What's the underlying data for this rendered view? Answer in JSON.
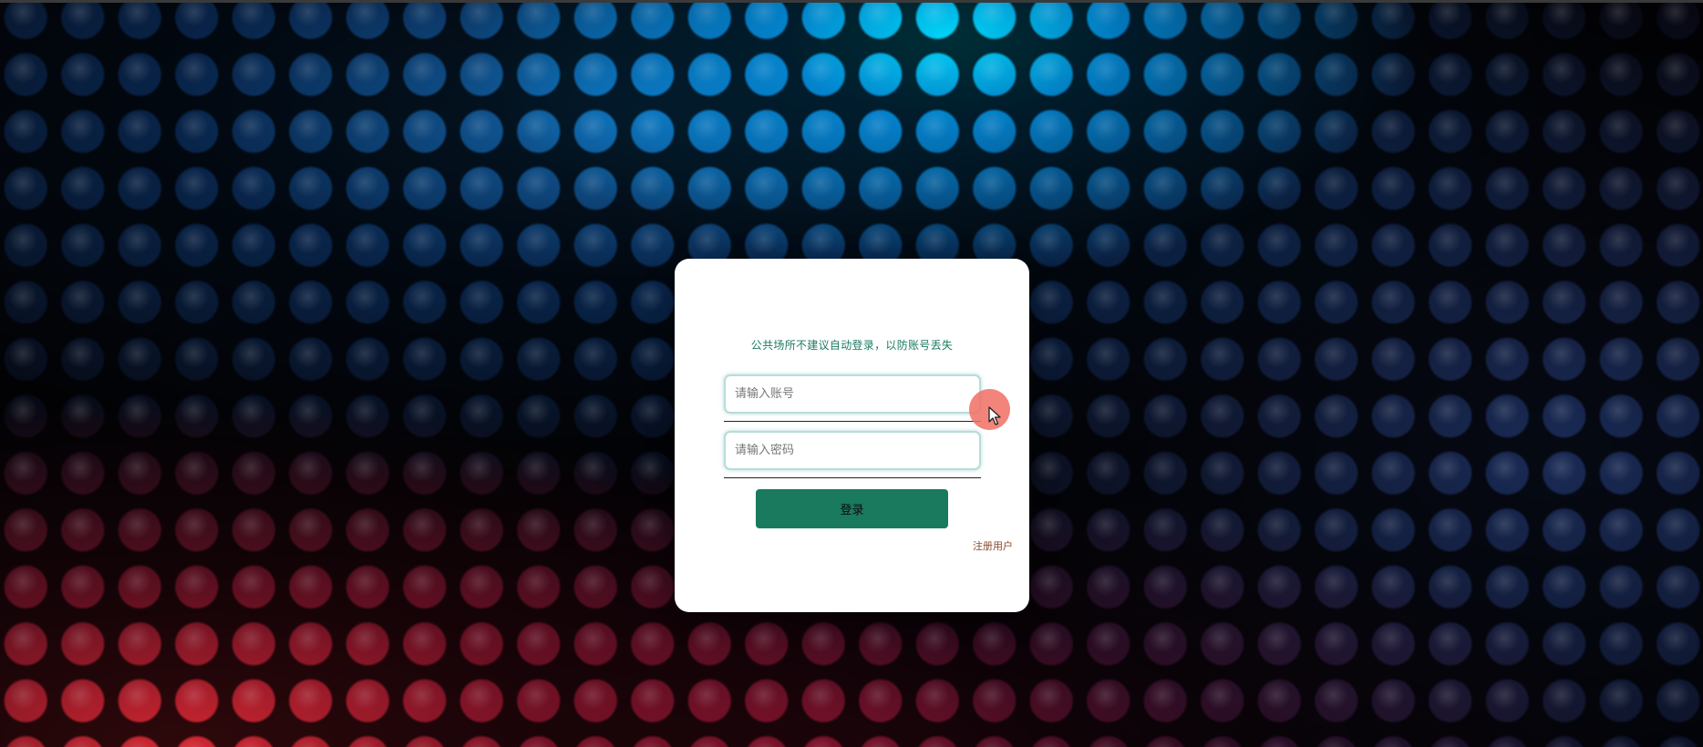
{
  "login": {
    "notice": "公共场所不建议自动登录，以防账号丢失",
    "username_placeholder": "请输入账号",
    "password_placeholder": "请输入密码",
    "login_label": "登录",
    "register_label": "注册用户"
  },
  "colors": {
    "accent": "#1a7a5e",
    "notice_text": "#1c7a62",
    "register_link": "#8a4a2a",
    "card": "#ffffff"
  },
  "icons": {
    "cursor": "mouse-pointer-icon"
  }
}
